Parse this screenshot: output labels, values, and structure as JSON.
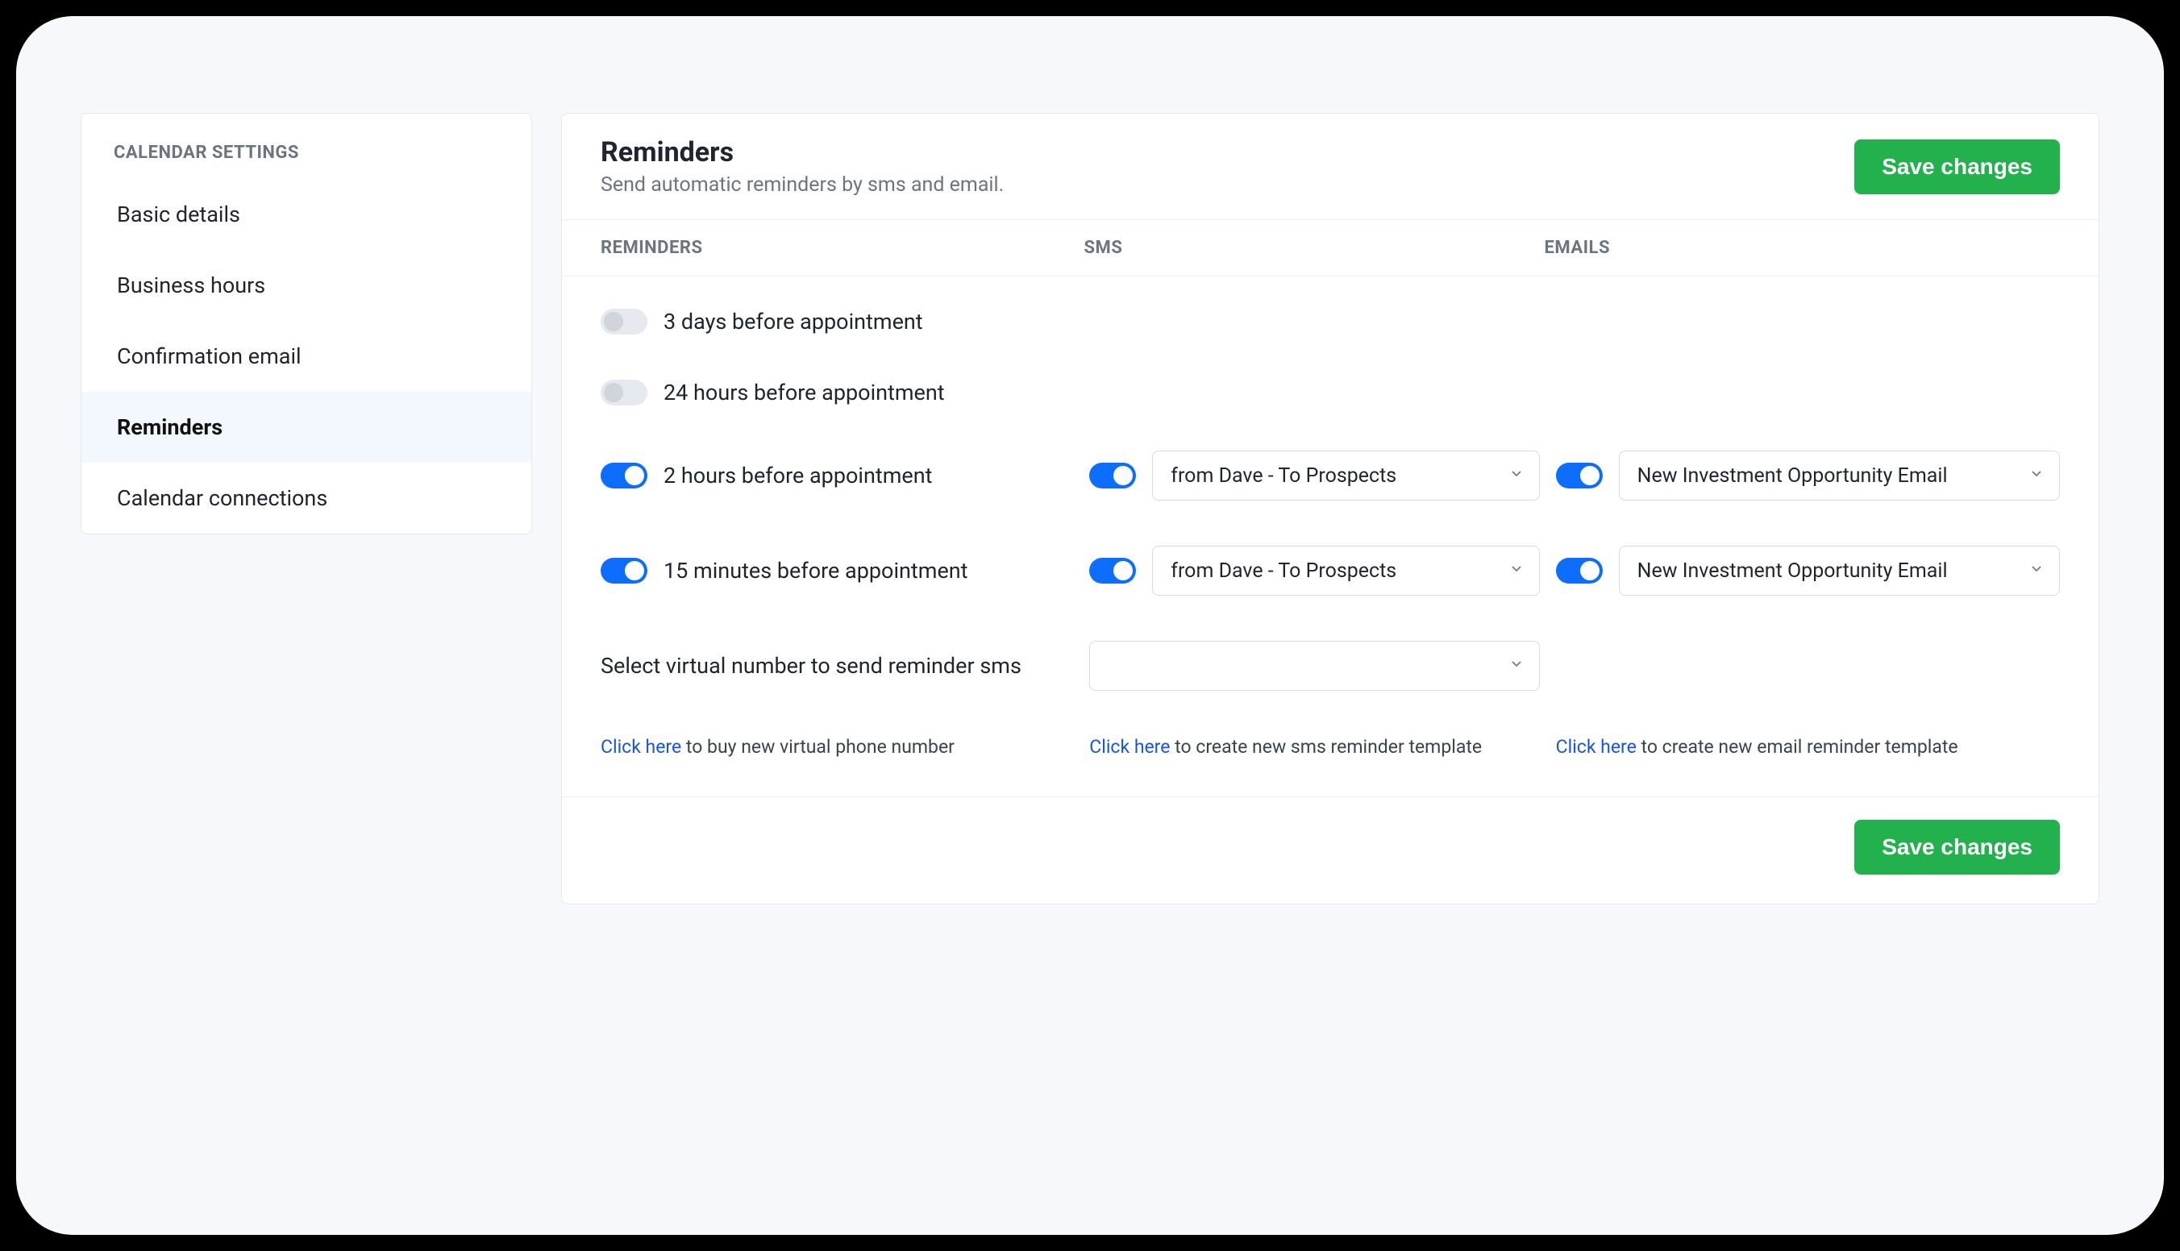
{
  "sidebar": {
    "title": "CALENDAR SETTINGS",
    "items": [
      {
        "label": "Basic details"
      },
      {
        "label": "Business hours"
      },
      {
        "label": "Confirmation email"
      },
      {
        "label": "Reminders"
      },
      {
        "label": "Calendar connections"
      }
    ],
    "active_index": 3
  },
  "header": {
    "title": "Reminders",
    "subtitle": "Send automatic reminders by sms and email.",
    "save_label": "Save changes"
  },
  "columns": {
    "reminders": "REMINDERS",
    "sms": "SMS",
    "emails": "EMAILS"
  },
  "reminders": [
    {
      "label": "3 days before appointment",
      "enabled": false,
      "sms_enabled": false,
      "sms_template": "",
      "email_enabled": false,
      "email_template": ""
    },
    {
      "label": "24 hours before appointment",
      "enabled": false,
      "sms_enabled": false,
      "sms_template": "",
      "email_enabled": false,
      "email_template": ""
    },
    {
      "label": "2 hours before appointment",
      "enabled": true,
      "sms_enabled": true,
      "sms_template": "from Dave - To Prospects",
      "email_enabled": true,
      "email_template": "New Investment Opportunity Email"
    },
    {
      "label": "15 minutes before appointment",
      "enabled": true,
      "sms_enabled": true,
      "sms_template": "from Dave - To Prospects",
      "email_enabled": true,
      "email_template": "New Investment Opportunity Email"
    }
  ],
  "virtual_number": {
    "label": "Select virtual number to send reminder sms",
    "value": ""
  },
  "links": {
    "buy_number": {
      "link": "Click here",
      "text": " to buy new virtual phone number"
    },
    "sms_template": {
      "link": "Click here",
      "text": " to create new sms reminder template"
    },
    "email_template": {
      "link": "Click here",
      "text": " to create new email reminder template"
    }
  },
  "footer": {
    "save_label": "Save changes"
  }
}
